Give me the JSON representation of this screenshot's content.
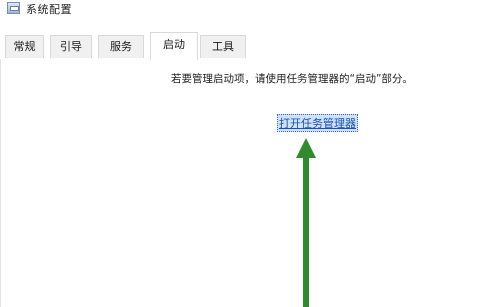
{
  "window": {
    "title": "系统配置",
    "icon": "system-config-icon"
  },
  "tabs": [
    {
      "label": "常规",
      "active": false
    },
    {
      "label": "引导",
      "active": false
    },
    {
      "label": "服务",
      "active": false
    },
    {
      "label": "启动",
      "active": true
    },
    {
      "label": "工具",
      "active": false
    }
  ],
  "startup": {
    "hint": "若要管理启动项，请使用任务管理器的“启动”部分。",
    "link_label": "打开任务管理器"
  },
  "annotation": {
    "arrow_color": "#2e8b2e",
    "icon": "green-arrow-up-icon"
  }
}
